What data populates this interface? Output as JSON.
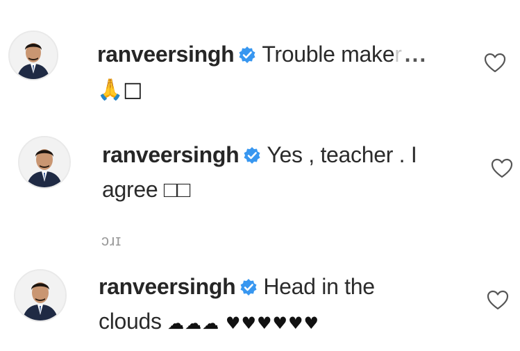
{
  "comments": [
    {
      "username": "ranveersingh",
      "text": "Trouble make",
      "faded_text": "r",
      "more": "...",
      "second_line": "🙏□"
    },
    {
      "username": "ranveersingh",
      "text": "Yes , teacher . I",
      "second_line": "agree □□"
    },
    {
      "username": "ranveersingh",
      "text": "Head in the",
      "second_line": "clouds",
      "emoji_tail": "☁☁☁ ♥♥♥♥♥♥"
    }
  ],
  "stray_text": "ɔɹɪ",
  "icons": {
    "verified": "verified-badge-icon",
    "like": "heart-icon",
    "avatar": "avatar-icon"
  },
  "colors": {
    "verified_blue": "#3897f0",
    "text": "#262626"
  }
}
